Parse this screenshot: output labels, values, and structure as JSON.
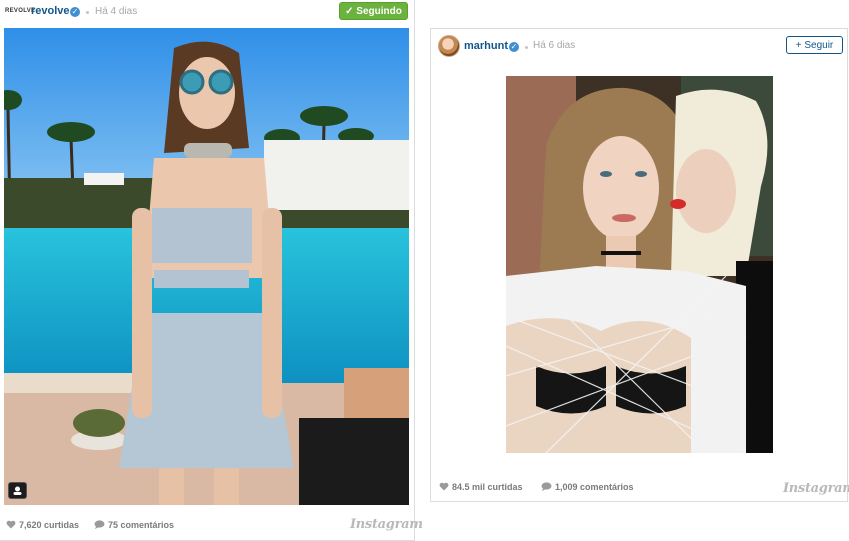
{
  "posts": [
    {
      "brand_logo_text": "REVOLVE",
      "username": "revolve",
      "time": "Há 4 dias",
      "follow_label": "Seguindo",
      "likes": "7,620 curtidas",
      "comments": "75 comentários",
      "watermark": "Instagram"
    },
    {
      "username": "marhunt",
      "time": "Há 6 dias",
      "follow_label": "+ Seguir",
      "likes": "84.5 mil curtidas",
      "comments": "1,009 comentários",
      "watermark": "Instagram"
    }
  ],
  "colors": {
    "username": "#125688",
    "following_green": "#6bb23f",
    "verified_blue": "#3f8fd2",
    "muted": "#a5a7aa"
  },
  "icons": [
    "verified-badge-icon",
    "checkmark-icon",
    "heart-icon",
    "comment-icon",
    "tagged-people-icon",
    "instagram-wordmark"
  ]
}
